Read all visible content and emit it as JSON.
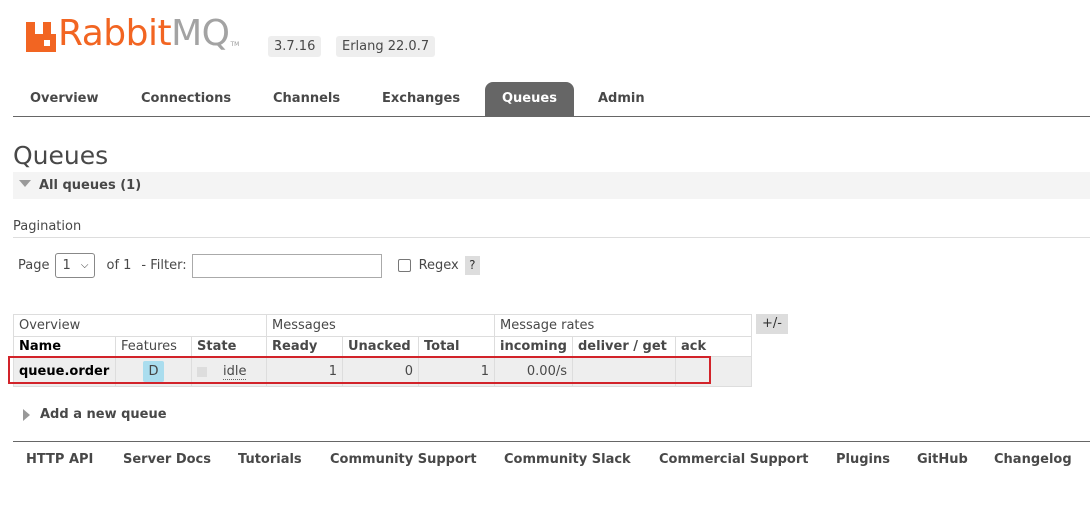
{
  "header": {
    "logo_rabbit": "Rabbit",
    "logo_mq": "MQ",
    "logo_tm": "TM",
    "version": "3.7.16",
    "erlang": "Erlang 22.0.7"
  },
  "tabs": [
    "Overview",
    "Connections",
    "Channels",
    "Exchanges",
    "Queues",
    "Admin"
  ],
  "active_tab": "Queues",
  "page_title": "Queues",
  "section": {
    "label": "All queues (1)"
  },
  "pagination": {
    "label": "Pagination",
    "page_label": "Page",
    "page_value": "1",
    "of_text": "of 1",
    "filter_label": "- Filter:",
    "filter_value": "",
    "regex_label": "Regex",
    "regex_help": "?"
  },
  "table": {
    "groups": [
      "Overview",
      "Messages",
      "Message rates"
    ],
    "columns": [
      "Name",
      "Features",
      "State",
      "Ready",
      "Unacked",
      "Total",
      "incoming",
      "deliver / get",
      "ack"
    ],
    "toggle_label": "+/-",
    "rows": [
      {
        "name": "queue.order",
        "feature": "D",
        "state": "idle",
        "ready": "1",
        "unacked": "0",
        "total": "1",
        "incoming": "0.00/s",
        "deliver_get": "",
        "ack": ""
      }
    ]
  },
  "add_queue_label": "Add a new queue",
  "footer": [
    "HTTP API",
    "Server Docs",
    "Tutorials",
    "Community Support",
    "Community Slack",
    "Commercial Support",
    "Plugins",
    "GitHub",
    "Changelog"
  ],
  "colors": {
    "brand_orange": "#f26522",
    "tab_active_bg": "#666666",
    "feature_badge": "#aaddee",
    "highlight_box": "#d2232a"
  }
}
